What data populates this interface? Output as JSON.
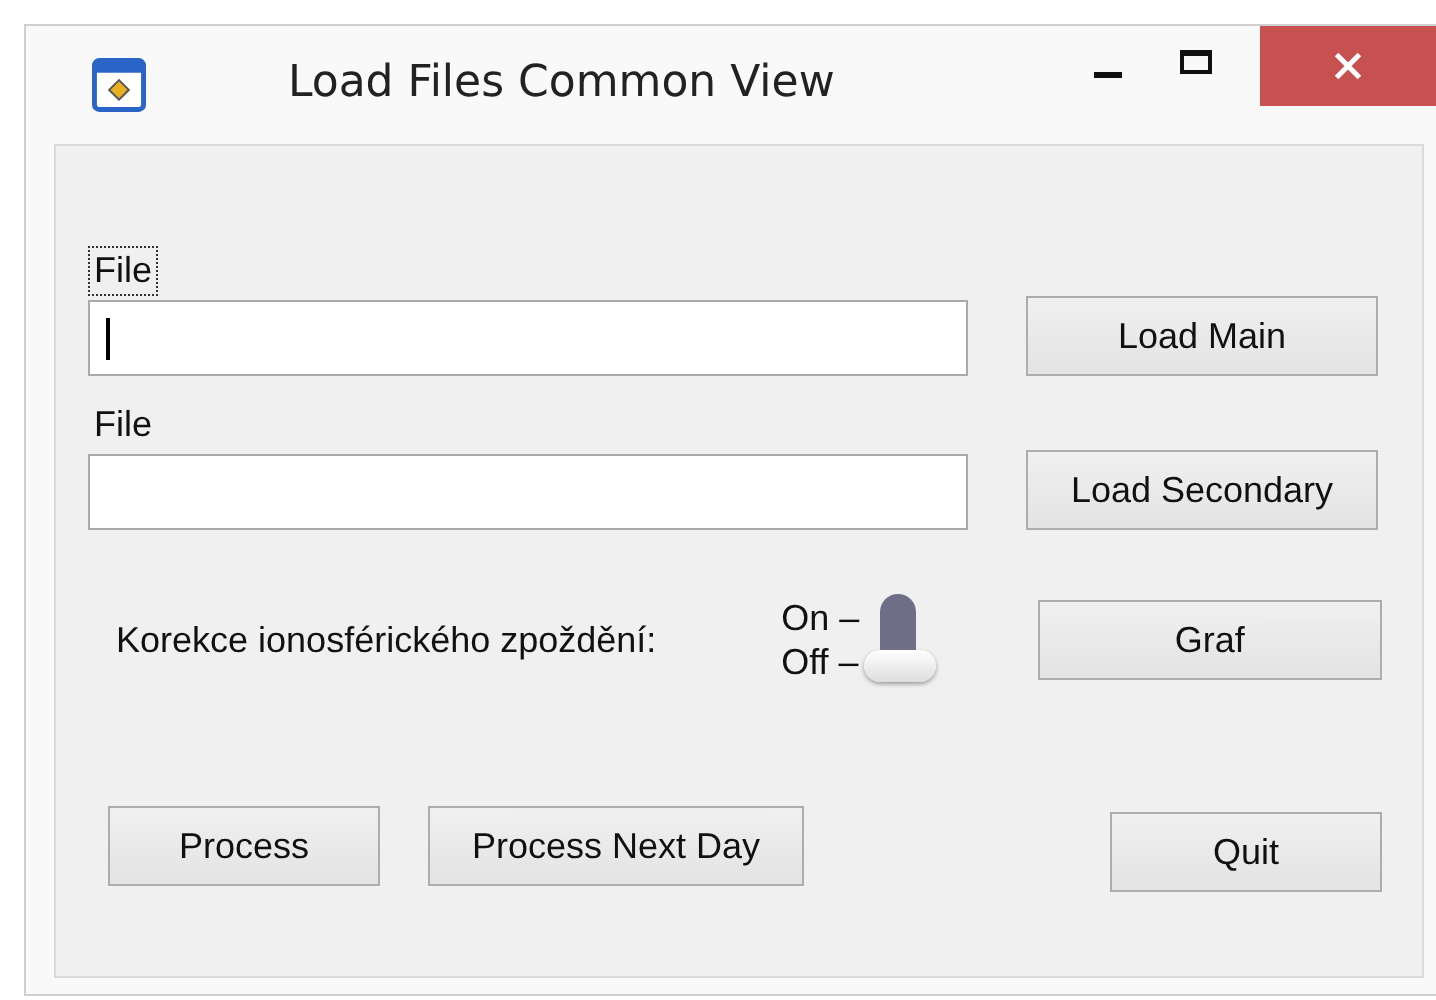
{
  "window": {
    "title": "Load Files Common View"
  },
  "files": [
    {
      "label": "File",
      "focused": true,
      "button": "Load Main"
    },
    {
      "label": "File",
      "focused": false,
      "button": "Load Secondary"
    }
  ],
  "correction": {
    "label": "Korekce ionosférického zpoždění:",
    "on_label": "On –",
    "off_label": "Off –",
    "on": false,
    "button": "Graf"
  },
  "actions": [
    {
      "label": "Process"
    },
    {
      "label": "Process Next Day"
    }
  ],
  "quit": "Quit"
}
